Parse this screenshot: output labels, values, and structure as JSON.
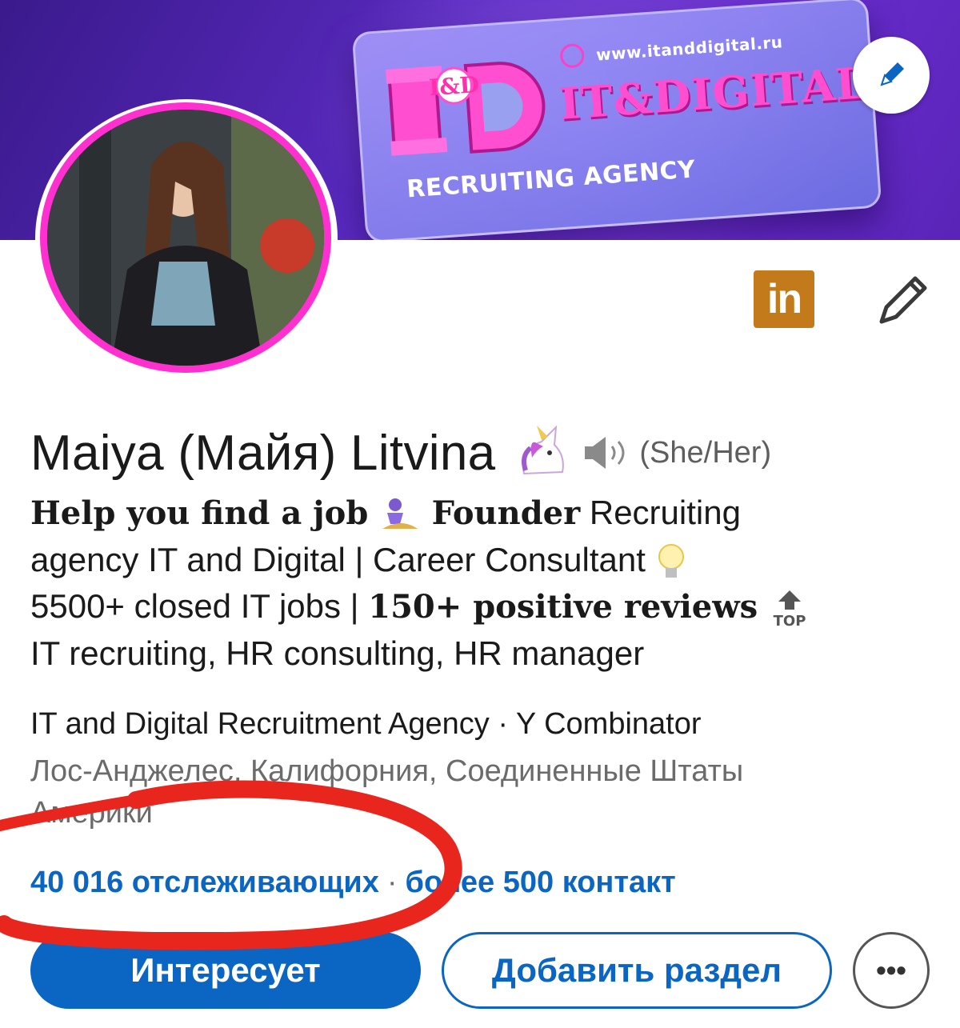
{
  "banner": {
    "url": "www.itanddigital.ru",
    "logo_letters": "I&D",
    "brand": "IT&DIGITAL",
    "subtitle": "RECRUITING AGENCY",
    "gradient_colors": [
      "#3a1a8c",
      "#6b2ed0"
    ]
  },
  "profile": {
    "name": "Maiya (Майя) Litvina",
    "pronouns": "(She/Her)",
    "headline": {
      "line1_bold": "Help you find a job",
      "line1_bold2": "Founder",
      "line1_rest": " Recruiting",
      "line2": "agency IT and Digital | Career Consultant",
      "line3_start": "5500+ closed IT jobs | ",
      "line3_bold": "150+ positive reviews",
      "line4": "IT recruiting, HR consulting, HR manager"
    },
    "company": "IT and Digital Recruitment Agency · Y Combinator",
    "location": "Лос-Анджелес, Калифорния, Соединенные Штаты Америки",
    "followers": "40 016 отслеживающих",
    "separator": "·",
    "connections": "более 500 контакт"
  },
  "actions": {
    "primary_label": "Интересует",
    "secondary_label": "Добавить раздел",
    "more_label": "•••"
  },
  "badges": {
    "linkedin_label": "in",
    "top_label": "TOP"
  },
  "colors": {
    "accent": "#0a66c2",
    "avatar_ring": "#ff2fd0",
    "linkedin_badge": "#c27a1a",
    "annotation": "#e8261e"
  }
}
